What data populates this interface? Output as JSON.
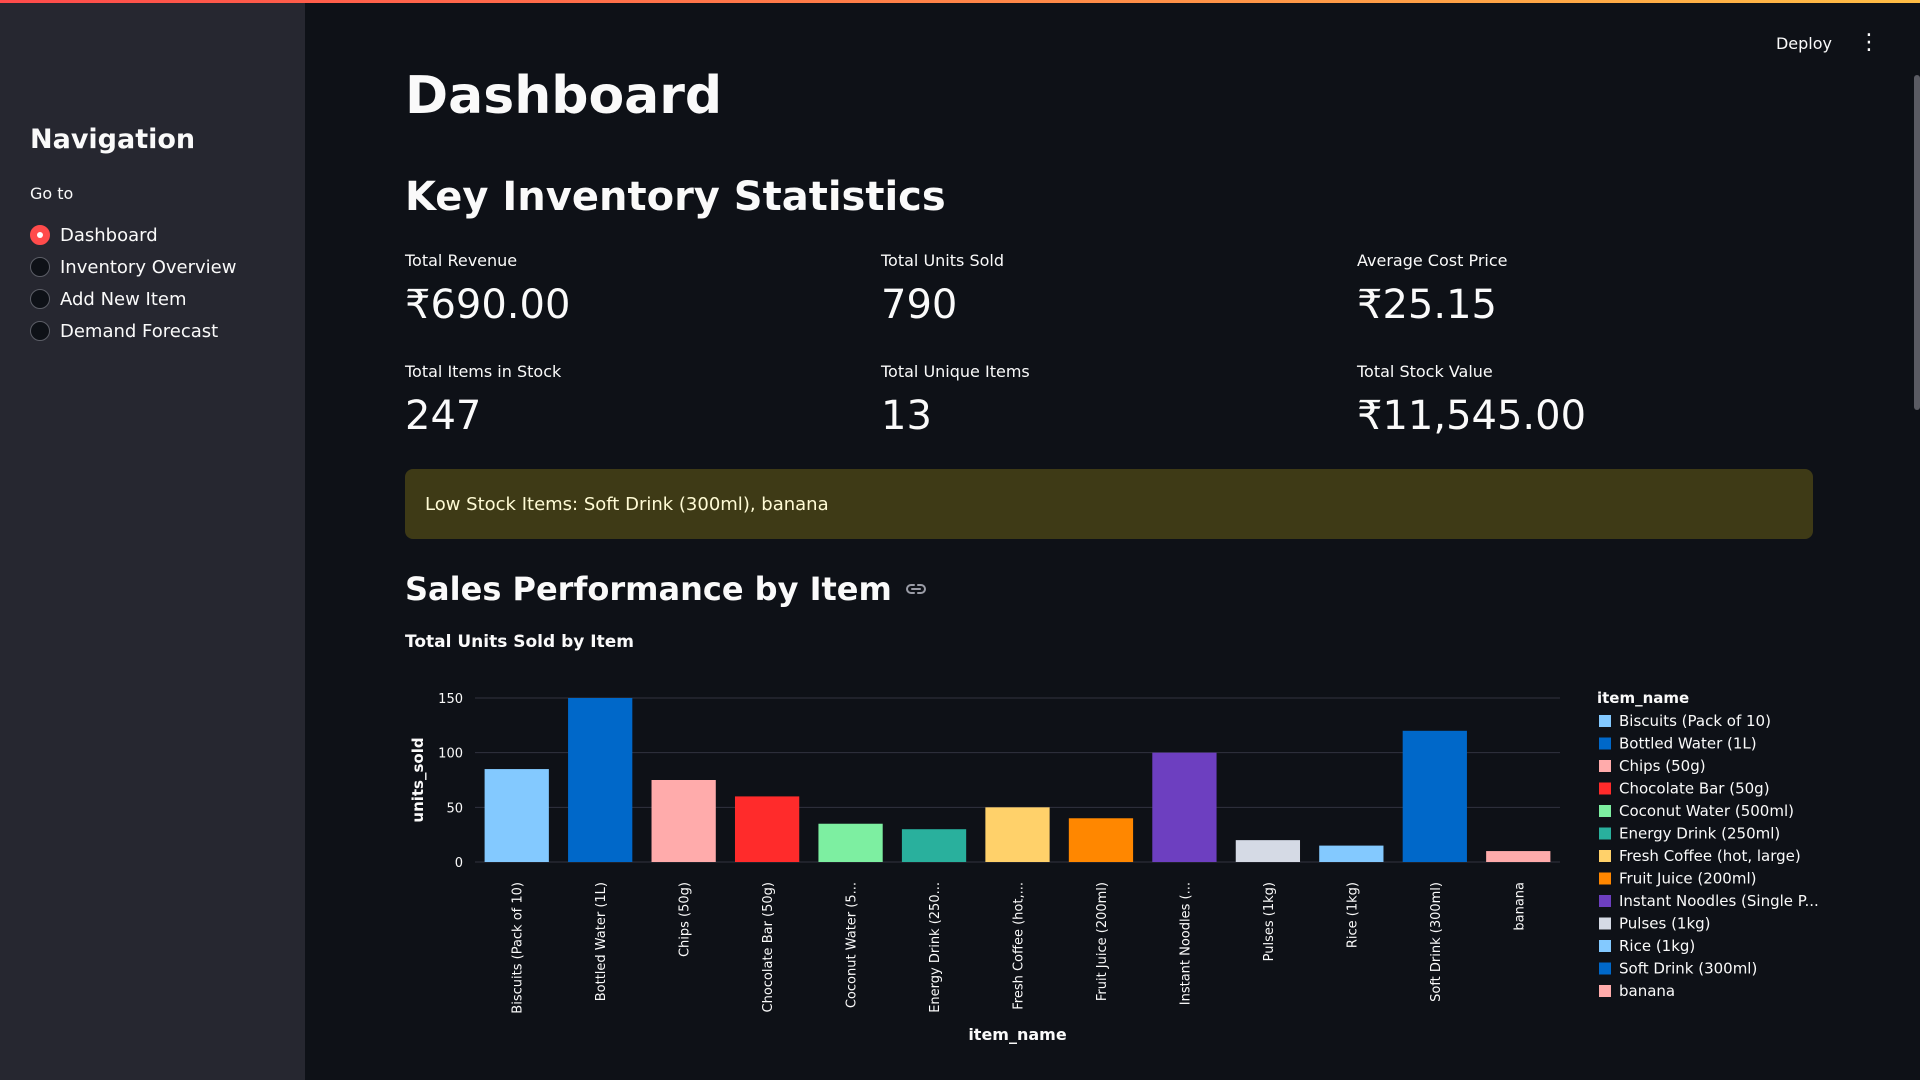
{
  "header": {
    "deploy_label": "Deploy",
    "menu_icon": "kebab-menu-icon"
  },
  "sidebar": {
    "title": "Navigation",
    "goto_label": "Go to",
    "items": [
      {
        "label": "Dashboard",
        "selected": true
      },
      {
        "label": "Inventory Overview",
        "selected": false
      },
      {
        "label": "Add New Item",
        "selected": false
      },
      {
        "label": "Demand Forecast",
        "selected": false
      }
    ]
  },
  "main": {
    "title": "Dashboard",
    "stats_title": "Key Inventory Statistics",
    "metrics": [
      {
        "label": "Total Revenue",
        "value": "₹690.00"
      },
      {
        "label": "Total Units Sold",
        "value": "790"
      },
      {
        "label": "Average Cost Price",
        "value": "₹25.15"
      },
      {
        "label": "Total Items in Stock",
        "value": "247"
      },
      {
        "label": "Total Unique Items",
        "value": "13"
      },
      {
        "label": "Total Stock Value",
        "value": "₹11,545.00"
      }
    ],
    "low_stock_message": "Low Stock Items: Soft Drink (300ml), banana",
    "sales_title": "Sales Performance by Item",
    "chart_title": "Total Units Sold by Item"
  },
  "colors": {
    "accent": "#ff4b4b",
    "warning_bg": "#3e3a16",
    "warning_text": "#fffbd5",
    "sidebar_bg": "#262730",
    "page_bg": "#0e1117"
  },
  "chart_data": {
    "type": "bar",
    "title": "Total Units Sold by Item",
    "xlabel": "item_name",
    "ylabel": "units_sold",
    "ylim": [
      0,
      150
    ],
    "yticks": [
      0,
      50,
      100,
      150
    ],
    "legend_title": "item_name",
    "legend_position": "right",
    "grid": true,
    "categories": [
      "Biscuits (Pack of 10)",
      "Bottled Water (1L)",
      "Chips (50g)",
      "Chocolate Bar (50g)",
      "Coconut Water (500ml)",
      "Energy Drink (250ml)",
      "Fresh Coffee (hot, large)",
      "Fruit Juice (200ml)",
      "Instant Noodles (Single Pack)",
      "Pulses (1kg)",
      "Rice (1kg)",
      "Soft Drink (300ml)",
      "banana"
    ],
    "tick_labels": [
      "Biscuits (Pack of 10)",
      "Bottled Water (1L)",
      "Chips (50g)",
      "Chocolate Bar (50g)",
      "Coconut Water (5...",
      "Energy Drink (250...",
      "Fresh Coffee (hot,...",
      "Fruit Juice (200ml)",
      "Instant Noodles (...",
      "Pulses (1kg)",
      "Rice (1kg)",
      "Soft Drink (300ml)",
      "banana"
    ],
    "legend_labels": [
      "Biscuits (Pack of 10)",
      "Bottled Water (1L)",
      "Chips (50g)",
      "Chocolate Bar (50g)",
      "Coconut Water (500ml)",
      "Energy Drink (250ml)",
      "Fresh Coffee (hot, large)",
      "Fruit Juice (200ml)",
      "Instant Noodles (Single P...",
      "Pulses (1kg)",
      "Rice (1kg)",
      "Soft Drink (300ml)",
      "banana"
    ],
    "values": [
      85,
      150,
      75,
      60,
      35,
      30,
      50,
      40,
      100,
      20,
      15,
      120,
      10
    ],
    "colors": [
      "#83c9ff",
      "#0068c9",
      "#ffabab",
      "#ff2b2b",
      "#7defa1",
      "#29b09d",
      "#ffd16a",
      "#ff8700",
      "#6d3fc0",
      "#d5dae5",
      "#83c9ff",
      "#0068c9",
      "#ffabab"
    ]
  }
}
